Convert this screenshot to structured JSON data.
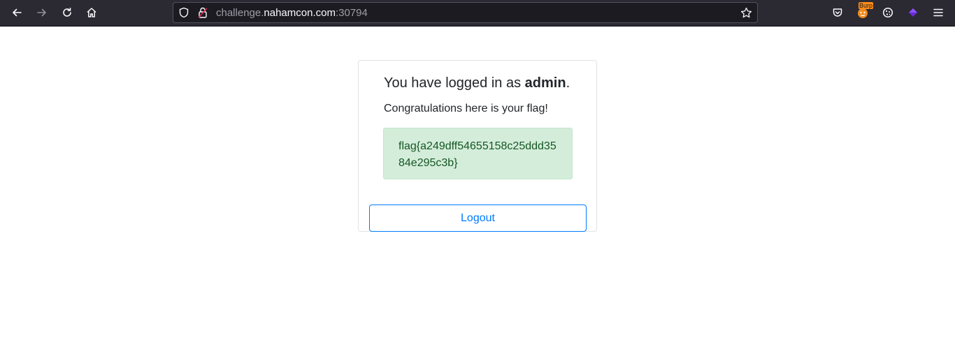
{
  "browser": {
    "url_host_prefix": "challenge.",
    "url_host_domain": "nahamcon.com",
    "url_port": ":30794",
    "burp_badge": "Burp"
  },
  "page": {
    "heading_prefix": "You have logged in as ",
    "username": "admin",
    "heading_suffix": ".",
    "congrats": "Congratulations here is your flag!",
    "flag": "flag{a249dff54655158c25ddd3584e295c3b}",
    "logout_label": "Logout"
  },
  "colors": {
    "toolbar_bg": "#2b2a33",
    "alert_bg": "#d4edda",
    "alert_text": "#155724",
    "button_outline": "#007bff"
  }
}
